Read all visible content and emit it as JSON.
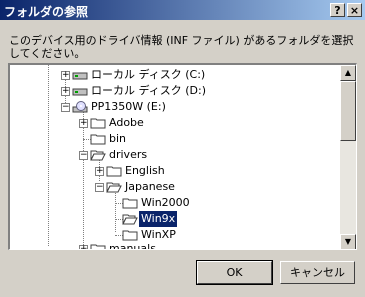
{
  "window": {
    "title": "フォルダの参照",
    "help_glyph": "?",
    "close_glyph": "×"
  },
  "description": "このデバイス用のドライバ情報 (INF ファイル) があるフォルダを選択してください。",
  "tree": {
    "items": [
      {
        "label": "ローカル ディスク (C:)",
        "icon": "drive-icon",
        "expander": "+"
      },
      {
        "label": "ローカル ディスク (D:)",
        "icon": "drive-icon",
        "expander": "+"
      },
      {
        "label": "PP1350W (E:)",
        "icon": "cd-drive-icon",
        "expander": "−"
      },
      {
        "label": "Adobe",
        "icon": "folder-icon",
        "expander": "+"
      },
      {
        "label": "bin",
        "icon": "folder-icon",
        "expander": ""
      },
      {
        "label": "drivers",
        "icon": "folder-open-icon",
        "expander": "−"
      },
      {
        "label": "English",
        "icon": "folder-icon",
        "expander": "+"
      },
      {
        "label": "Japanese",
        "icon": "folder-open-icon",
        "expander": "−"
      },
      {
        "label": "Win2000",
        "icon": "folder-icon",
        "expander": ""
      },
      {
        "label": "Win9x",
        "icon": "folder-open-icon",
        "expander": "",
        "selected": true
      },
      {
        "label": "WinXP",
        "icon": "folder-icon",
        "expander": ""
      },
      {
        "label": "manuals",
        "icon": "folder-icon",
        "expander": "+"
      }
    ]
  },
  "buttons": {
    "ok": "OK",
    "cancel": "キャンセル"
  }
}
